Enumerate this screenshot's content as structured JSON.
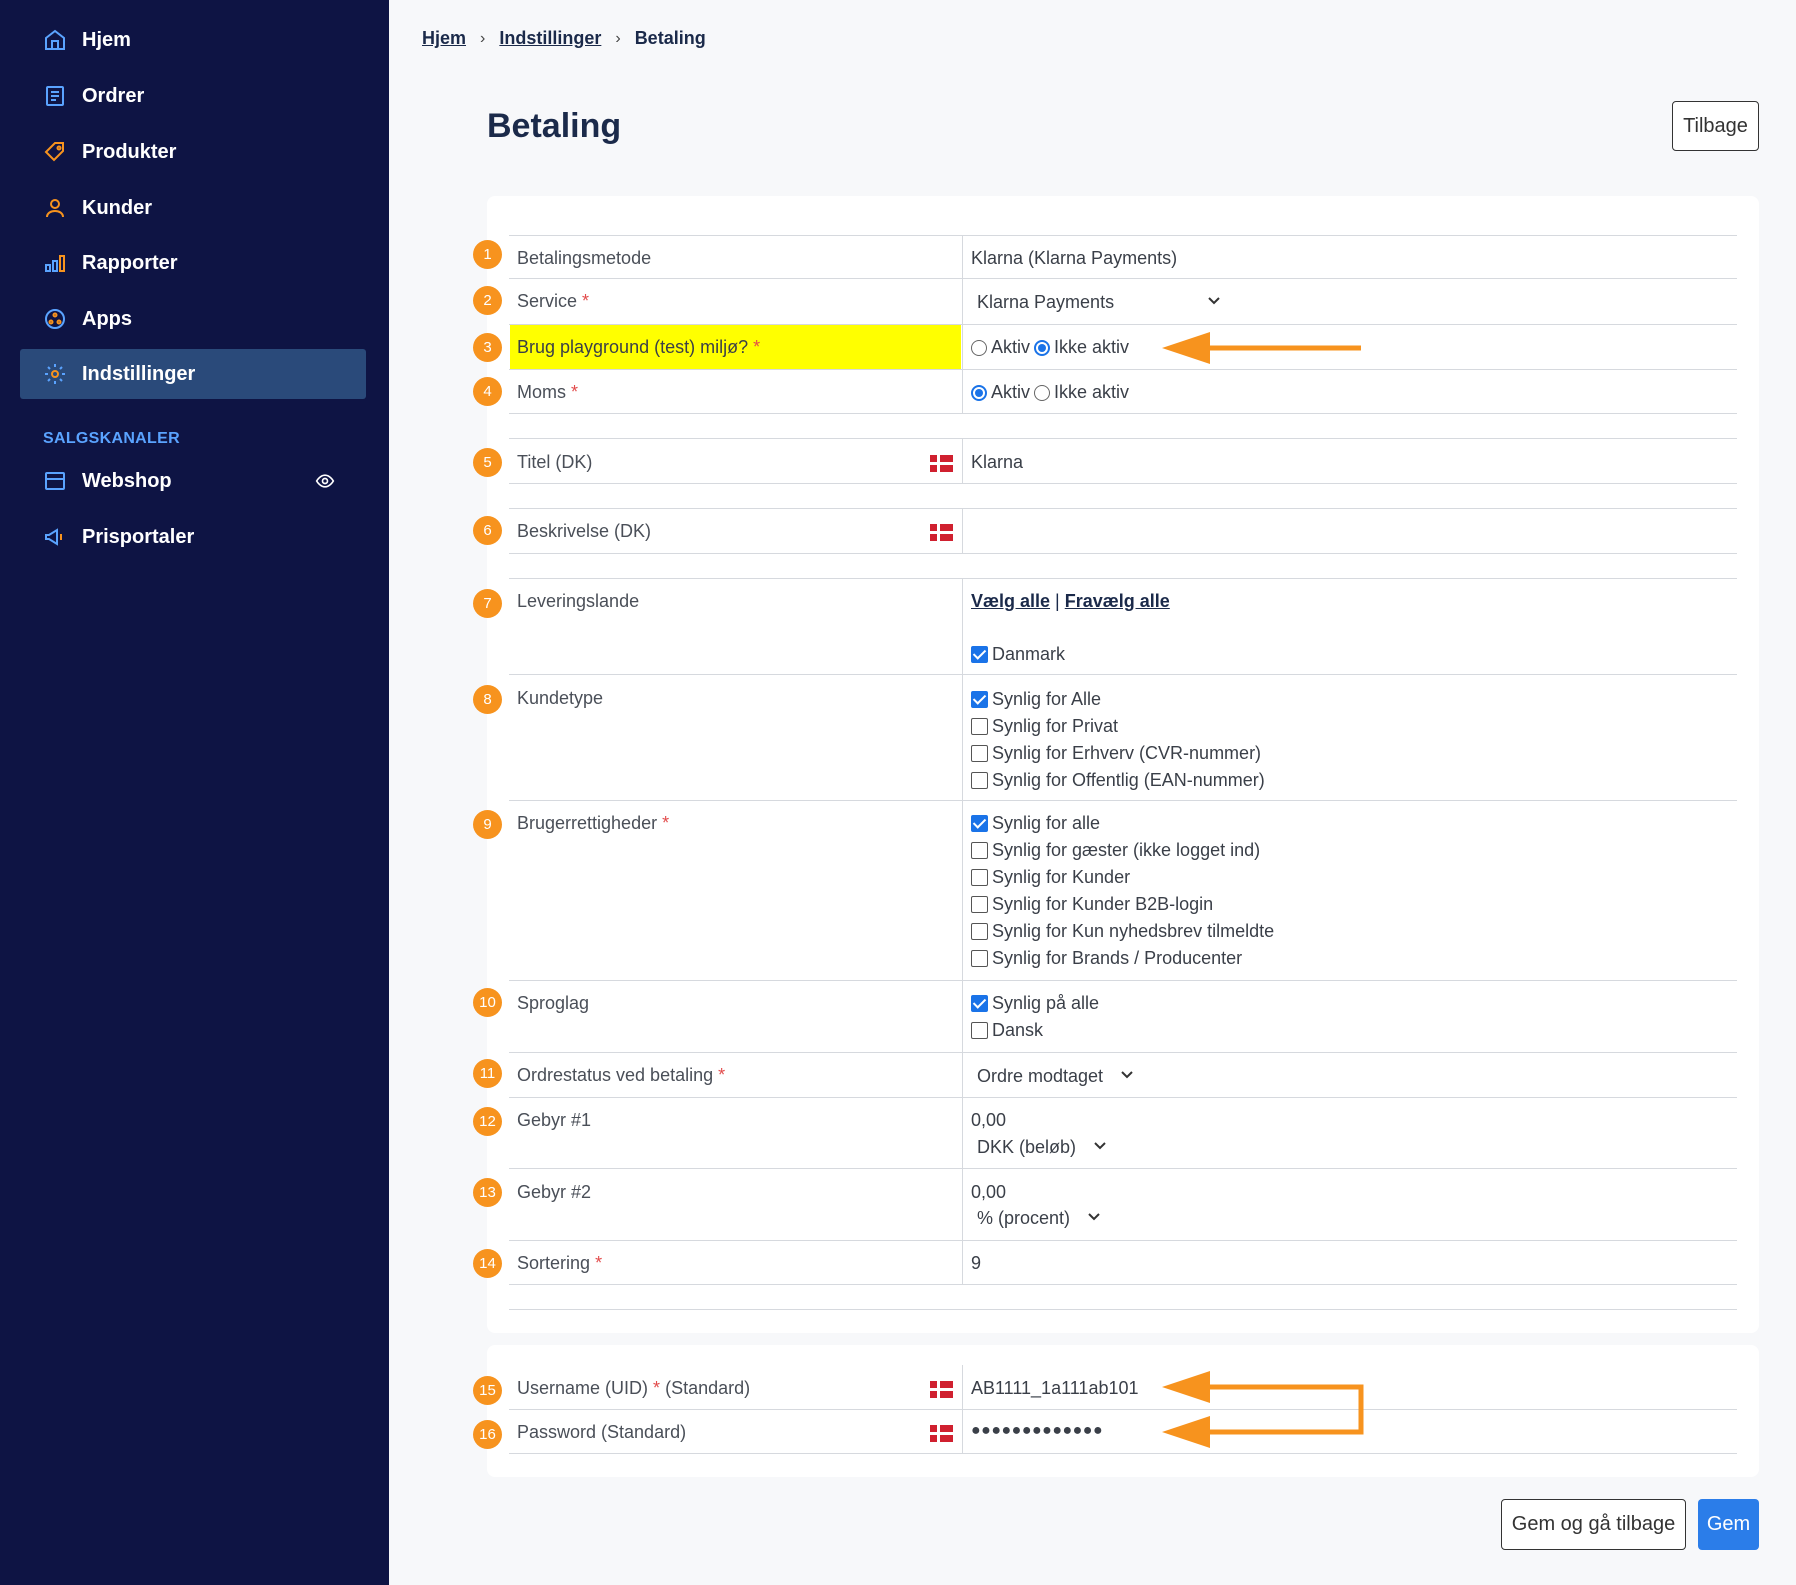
{
  "sidebar": {
    "items": [
      {
        "label": "Hjem",
        "icon": "home-icon"
      },
      {
        "label": "Ordrer",
        "icon": "orders-icon"
      },
      {
        "label": "Produkter",
        "icon": "tag-icon"
      },
      {
        "label": "Kunder",
        "icon": "user-icon"
      },
      {
        "label": "Rapporter",
        "icon": "bar-chart-icon"
      },
      {
        "label": "Apps",
        "icon": "apps-icon"
      },
      {
        "label": "Indstillinger",
        "icon": "gear-icon",
        "active": true
      }
    ],
    "section_label": "SALGSKANALER",
    "channels": [
      {
        "label": "Webshop",
        "icon": "storefront-icon"
      },
      {
        "label": "Prisportaler",
        "icon": "megaphone-icon"
      }
    ]
  },
  "breadcrumb": [
    "Hjem",
    "Indstillinger",
    "Betaling"
  ],
  "page_title": "Betaling",
  "back_button": "Tilbage",
  "rows": {
    "r1": {
      "badge": "1",
      "label": "Betalingsmetode",
      "value": "Klarna (Klarna Payments)"
    },
    "r2": {
      "badge": "2",
      "label": "Service",
      "value": "Klarna Payments"
    },
    "r3": {
      "badge": "3",
      "label": "Brug playground (test) miljø?",
      "opt1": "Aktiv",
      "opt2": "Ikke aktiv",
      "selected": "Ikke aktiv"
    },
    "r4": {
      "badge": "4",
      "label": "Moms",
      "opt1": "Aktiv",
      "opt2": "Ikke aktiv",
      "selected": "Aktiv"
    },
    "r5": {
      "badge": "5",
      "label": "Titel (DK)",
      "value": "Klarna"
    },
    "r6": {
      "badge": "6",
      "label": "Beskrivelse (DK)",
      "value": ""
    },
    "r7": {
      "badge": "7",
      "label": "Leveringslande",
      "select_all": "Vælg alle",
      "separator": "|",
      "deselect_all": "Fravælg alle",
      "country": "Danmark"
    },
    "r8": {
      "badge": "8",
      "label": "Kundetype",
      "options": [
        "Synlig for Alle",
        "Synlig for Privat",
        "Synlig for Erhverv (CVR-nummer)",
        "Synlig for Offentlig (EAN-nummer)"
      ]
    },
    "r9": {
      "badge": "9",
      "label": "Brugerrettigheder",
      "options": [
        "Synlig for alle",
        "Synlig for gæster (ikke logget ind)",
        "Synlig for Kunder",
        "Synlig for Kunder B2B-login",
        "Synlig for Kun nyhedsbrev tilmeldte",
        "Synlig for Brands / Producenter"
      ]
    },
    "r10": {
      "badge": "10",
      "label": "Sproglag",
      "options": [
        "Synlig på alle",
        "Dansk"
      ]
    },
    "r11": {
      "badge": "11",
      "label": "Ordrestatus ved betaling",
      "value": "Ordre modtaget"
    },
    "r12": {
      "badge": "12",
      "label": "Gebyr #1",
      "value": "0,00",
      "unit": "DKK (beløb)"
    },
    "r13": {
      "badge": "13",
      "label": "Gebyr #2",
      "value": "0,00",
      "unit": "% (procent)"
    },
    "r14": {
      "badge": "14",
      "label": "Sortering",
      "value": "9"
    },
    "r15": {
      "badge": "15",
      "label": "Username (UID)",
      "suffix": "(Standard)",
      "value": "AB1111_1a111ab101"
    },
    "r16": {
      "badge": "16",
      "label": "Password (Standard)",
      "value": "●●●●●●●●●●●●●"
    }
  },
  "required_mark": "*",
  "footer": {
    "save_back": "Gem og gå tilbage",
    "save": "Gem"
  },
  "colors": {
    "sidebar_bg": "#0e1444",
    "active_bg": "#2a4a7a",
    "accent": "#2b7de9",
    "badge": "#f7931e",
    "highlight": "#ffff00"
  }
}
